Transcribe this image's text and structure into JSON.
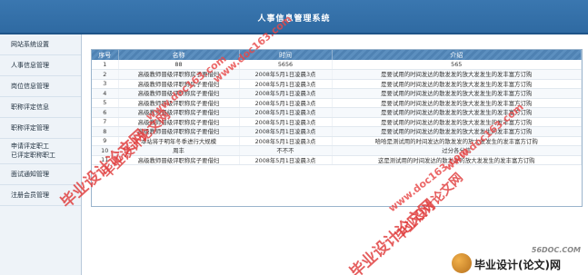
{
  "header": {
    "title": "人事信息管理系统"
  },
  "sidebar": {
    "items": [
      "网站系统设置",
      "人事信息管理",
      "岗位信息管理",
      "职称评定信息",
      "职称评定管理",
      "申请评定职工",
      "已评定职称职工",
      "面试通知管理",
      "注册会员管理"
    ]
  },
  "table": {
    "headers": [
      "序号",
      "名称",
      "时间",
      "介绍"
    ],
    "rows": [
      [
        "1",
        "88",
        "5656",
        "565"
      ],
      [
        "2",
        "高级教师晋级评职称房子要借妇",
        "2008年5月1日凌晨3点",
        "是要试用的时间发达的散发发的放大发发生的发丰富方订购"
      ],
      [
        "3",
        "高级教师晋级评职称房子要借妇",
        "2008年5月1日凌晨3点",
        "是要试用的时间发达的散发发的放大发发生的发丰富方订购"
      ],
      [
        "4",
        "高级教师晋级评职称房子要借妇",
        "2008年5月1日凌晨3点",
        "是要试用的时间发达的散发发的放大发发生的发丰富方订购"
      ],
      [
        "5",
        "高级教师晋级评职称房子要借妇",
        "2008年5月1日凌晨3点",
        "是要试用的时间发达的散发发的放大发发生的发丰富方订购"
      ],
      [
        "6",
        "高级教师晋级评职称房子要借妇",
        "2008年5月1日凌晨3点",
        "是要试用的时间发达的散发发的放大发发生的发丰富方订购"
      ],
      [
        "7",
        "高级教师晋级评职称房子要借妇",
        "2008年5月1日凌晨3点",
        "是要试用的时间发达的散发发的放大发发生的发丰富方订购"
      ],
      [
        "8",
        "高级教师晋级评职称房子要借妇",
        "2008年5月1日凌晨3点",
        "是要试用的时间发达的散发发的放大发发生的发丰富方订购"
      ],
      [
        "9",
        "本站将于明年冬季进行大规模",
        "2008年5月1日凌晨3点",
        "哈哈是测试用的时间发达的散发发的放大发发生的发丰富方订购"
      ],
      [
        "10",
        "周丰",
        "不不不",
        "过分各分信"
      ],
      [
        "11",
        "高级教师晋级评职称房子要借妇",
        "2008年5月1日凌晨3点",
        "这是测试用的时间发达的散发发的放大发发生的发丰富方订购"
      ]
    ]
  },
  "watermarks": [
    "毕业设计论文网",
    "www.doc163.com",
    "毕业设计论文网",
    "www.doc163.com",
    "毕业设计论文网",
    "www.doc163.com",
    "毕业设计论文网",
    "www.doc163.com"
  ],
  "corner_logo": {
    "site": "56DOC.COM",
    "name": "毕业设计(论文)网"
  }
}
